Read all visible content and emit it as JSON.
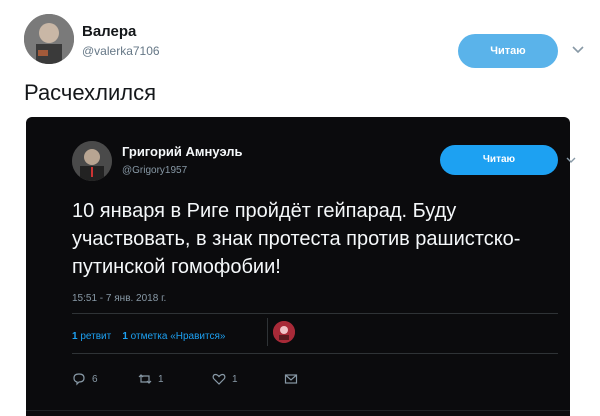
{
  "outer_tweet": {
    "author_name": "Валера",
    "handle": "@valerka7106",
    "follow_label": "Читаю",
    "text": "Расчехлился"
  },
  "embedded_tweet": {
    "author_name": "Григорий Амнуэль",
    "handle": "@Grigory1957",
    "follow_label": "Читаю",
    "text": "10 января в Риге пройдёт гейпарад. Буду участвовать, в знак протеста против рашистско-путинской гомофобии!",
    "timestamp": "15:51 - 7 янв. 2018 г.",
    "retweets_count": "1",
    "retweets_label": "ретвит",
    "likes_count": "1",
    "likes_label": "отметка «Нравится»",
    "actions": {
      "reply_count": "6",
      "retweet_count": "1",
      "like_count": "1"
    }
  },
  "colors": {
    "follow_button_outer": "#5ab3ea",
    "follow_button_inner": "#1da1f2",
    "embed_background": "#0b0b0d"
  }
}
